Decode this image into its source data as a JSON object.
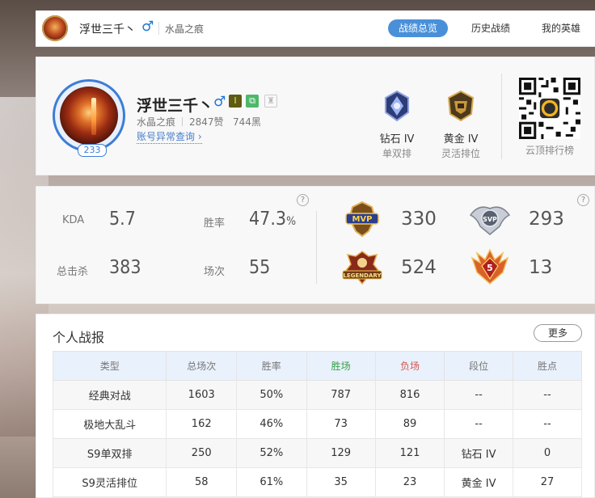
{
  "header": {
    "name": "浮世三千丶",
    "gender": "♂",
    "server": "水晶之痕",
    "nav": [
      {
        "label": "战绩总览",
        "active": true
      },
      {
        "label": "历史战绩",
        "active": false
      },
      {
        "label": "我的英雄",
        "active": false
      }
    ]
  },
  "profile": {
    "level": "233",
    "name": "浮世三千丶",
    "gender": "♂",
    "server": "水晶之痕",
    "likes": "2847赞",
    "blacks": "744黑",
    "abnormal_link": "账号异常查询",
    "ranks": [
      {
        "tier": "钻石 IV",
        "mode": "单双排",
        "color": "#5b6fb5"
      },
      {
        "tier": "黄金 IV",
        "mode": "灵活排位",
        "color": "#b8893a"
      }
    ],
    "qr_label": "云顶排行榜"
  },
  "stats": {
    "kda_label": "KDA",
    "kda_value": "5.7",
    "winrate_label": "胜率",
    "winrate_value": "47.3",
    "winrate_unit": "%",
    "kills_label": "总击杀",
    "kills_value": "383",
    "games_label": "场次",
    "games_value": "55",
    "help": "?",
    "honors": [
      {
        "icon": "mvp-badge-icon",
        "value": "330"
      },
      {
        "icon": "svp-badge-icon",
        "value": "293"
      },
      {
        "icon": "legendary-badge-icon",
        "value": "524"
      },
      {
        "icon": "penta-kill-badge-icon",
        "value": "13",
        "badge_text": "5"
      }
    ]
  },
  "report": {
    "title": "个人战报",
    "more": "更多",
    "columns": [
      "类型",
      "总场次",
      "胜率",
      "胜场",
      "负场",
      "段位",
      "胜点"
    ],
    "rows": [
      [
        "经典对战",
        "1603",
        "50%",
        "787",
        "816",
        "--",
        "--"
      ],
      [
        "极地大乱斗",
        "162",
        "46%",
        "73",
        "89",
        "--",
        "--"
      ],
      [
        "S9单双排",
        "250",
        "52%",
        "129",
        "121",
        "钻石 IV",
        "0"
      ],
      [
        "S9灵活排位",
        "58",
        "61%",
        "35",
        "23",
        "黄金 IV",
        "27"
      ]
    ]
  },
  "colors": {
    "accent": "#4a90d9",
    "win": "#35a046",
    "loss": "#d9534f"
  }
}
